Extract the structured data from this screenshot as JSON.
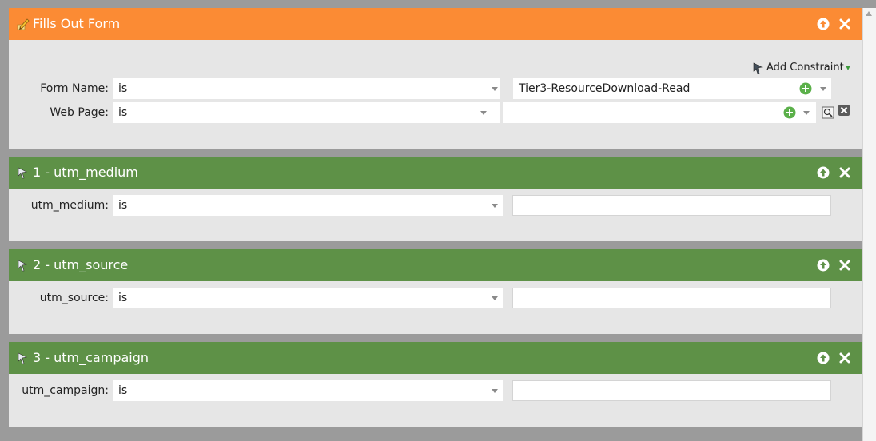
{
  "filters": [
    {
      "title": "Fills Out Form",
      "color": "#fb8b34",
      "icon": "form-pencil-icon",
      "add_constraint_label": "Add Constraint",
      "rows": [
        {
          "label": "Form Name:",
          "operator": "is",
          "value": "Tier3-ResourceDownload-Read"
        },
        {
          "label": "Web Page:",
          "operator": "is",
          "value": ""
        }
      ]
    },
    {
      "title": "1 - utm_medium",
      "color": "#5e9147",
      "icon": "filter-wand-icon",
      "rows": [
        {
          "label": "utm_medium:",
          "operator": "is",
          "value": ""
        }
      ]
    },
    {
      "title": "2 - utm_source",
      "color": "#5e9147",
      "icon": "filter-wand-icon",
      "rows": [
        {
          "label": "utm_source:",
          "operator": "is",
          "value": ""
        }
      ]
    },
    {
      "title": "3 - utm_campaign",
      "color": "#5e9147",
      "icon": "filter-wand-icon",
      "rows": [
        {
          "label": "utm_campaign:",
          "operator": "is",
          "value": ""
        }
      ]
    }
  ]
}
